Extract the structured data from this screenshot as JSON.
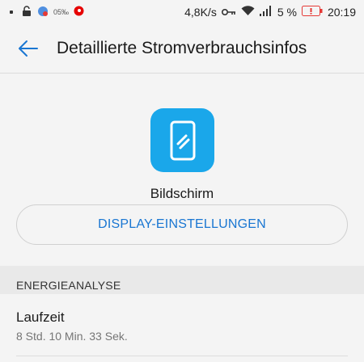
{
  "status_bar": {
    "small_indicator": "05‰",
    "network_speed": "4,8K/s",
    "battery_percent": "5 %",
    "time": "20:19"
  },
  "header": {
    "title": "Detaillierte Stromverbrauchsinfos",
    "back_icon": "arrow-left-icon"
  },
  "app": {
    "icon": "phone-screen-icon",
    "icon_color": "#1aa7ea",
    "name": "Bildschirm",
    "action_button": "DISPLAY-EINSTELLUNGEN"
  },
  "energy": {
    "section_title": "ENERGIEANALYSE",
    "items": [
      {
        "title": "Laufzeit",
        "value": "8 Std. 10 Min. 33 Sek."
      }
    ]
  },
  "colors": {
    "accent": "#1976d2",
    "battery_low": "#e53935"
  }
}
